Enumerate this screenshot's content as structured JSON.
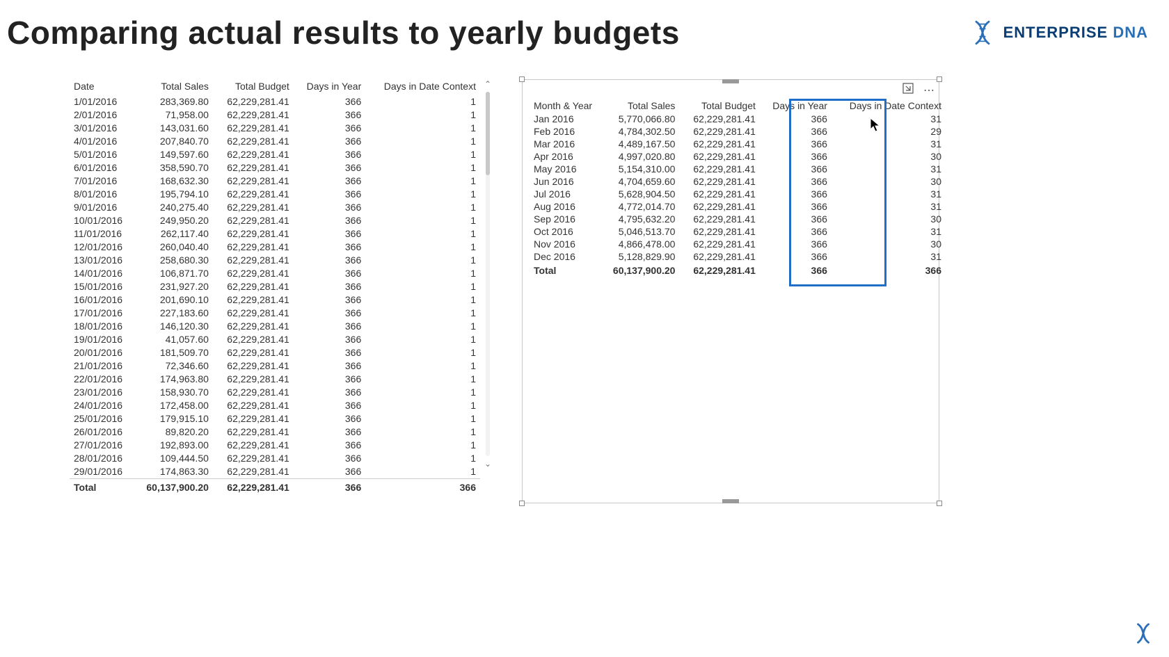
{
  "page_title": "Comparing actual results to yearly budgets",
  "brand": {
    "name1": "ENTERPRISE ",
    "name2": "DNA"
  },
  "left": {
    "headers": [
      "Date",
      "Total Sales",
      "Total Budget",
      "Days in Year",
      "Days in Date Context"
    ],
    "rows": [
      [
        "1/01/2016",
        "283,369.80",
        "62,229,281.41",
        "366",
        "1"
      ],
      [
        "2/01/2016",
        "71,958.00",
        "62,229,281.41",
        "366",
        "1"
      ],
      [
        "3/01/2016",
        "143,031.60",
        "62,229,281.41",
        "366",
        "1"
      ],
      [
        "4/01/2016",
        "207,840.70",
        "62,229,281.41",
        "366",
        "1"
      ],
      [
        "5/01/2016",
        "149,597.60",
        "62,229,281.41",
        "366",
        "1"
      ],
      [
        "6/01/2016",
        "358,590.70",
        "62,229,281.41",
        "366",
        "1"
      ],
      [
        "7/01/2016",
        "168,632.30",
        "62,229,281.41",
        "366",
        "1"
      ],
      [
        "8/01/2016",
        "195,794.10",
        "62,229,281.41",
        "366",
        "1"
      ],
      [
        "9/01/2016",
        "240,275.40",
        "62,229,281.41",
        "366",
        "1"
      ],
      [
        "10/01/2016",
        "249,950.20",
        "62,229,281.41",
        "366",
        "1"
      ],
      [
        "11/01/2016",
        "262,117.40",
        "62,229,281.41",
        "366",
        "1"
      ],
      [
        "12/01/2016",
        "260,040.40",
        "62,229,281.41",
        "366",
        "1"
      ],
      [
        "13/01/2016",
        "258,680.30",
        "62,229,281.41",
        "366",
        "1"
      ],
      [
        "14/01/2016",
        "106,871.70",
        "62,229,281.41",
        "366",
        "1"
      ],
      [
        "15/01/2016",
        "231,927.20",
        "62,229,281.41",
        "366",
        "1"
      ],
      [
        "16/01/2016",
        "201,690.10",
        "62,229,281.41",
        "366",
        "1"
      ],
      [
        "17/01/2016",
        "227,183.60",
        "62,229,281.41",
        "366",
        "1"
      ],
      [
        "18/01/2016",
        "146,120.30",
        "62,229,281.41",
        "366",
        "1"
      ],
      [
        "19/01/2016",
        "41,057.60",
        "62,229,281.41",
        "366",
        "1"
      ],
      [
        "20/01/2016",
        "181,509.70",
        "62,229,281.41",
        "366",
        "1"
      ],
      [
        "21/01/2016",
        "72,346.60",
        "62,229,281.41",
        "366",
        "1"
      ],
      [
        "22/01/2016",
        "174,963.80",
        "62,229,281.41",
        "366",
        "1"
      ],
      [
        "23/01/2016",
        "158,930.70",
        "62,229,281.41",
        "366",
        "1"
      ],
      [
        "24/01/2016",
        "172,458.00",
        "62,229,281.41",
        "366",
        "1"
      ],
      [
        "25/01/2016",
        "179,915.10",
        "62,229,281.41",
        "366",
        "1"
      ],
      [
        "26/01/2016",
        "89,820.20",
        "62,229,281.41",
        "366",
        "1"
      ],
      [
        "27/01/2016",
        "192,893.00",
        "62,229,281.41",
        "366",
        "1"
      ],
      [
        "28/01/2016",
        "109,444.50",
        "62,229,281.41",
        "366",
        "1"
      ],
      [
        "29/01/2016",
        "174,863.30",
        "62,229,281.41",
        "366",
        "1"
      ]
    ],
    "total": [
      "Total",
      "60,137,900.20",
      "62,229,281.41",
      "366",
      "366"
    ]
  },
  "right": {
    "headers": [
      "Month & Year",
      "Total Sales",
      "Total Budget",
      "Days in Year",
      "Days in Date Context"
    ],
    "rows": [
      [
        "Jan 2016",
        "5,770,066.80",
        "62,229,281.41",
        "366",
        "31"
      ],
      [
        "Feb 2016",
        "4,784,302.50",
        "62,229,281.41",
        "366",
        "29"
      ],
      [
        "Mar 2016",
        "4,489,167.50",
        "62,229,281.41",
        "366",
        "31"
      ],
      [
        "Apr 2016",
        "4,997,020.80",
        "62,229,281.41",
        "366",
        "30"
      ],
      [
        "May 2016",
        "5,154,310.00",
        "62,229,281.41",
        "366",
        "31"
      ],
      [
        "Jun 2016",
        "4,704,659.60",
        "62,229,281.41",
        "366",
        "30"
      ],
      [
        "Jul 2016",
        "5,628,904.50",
        "62,229,281.41",
        "366",
        "31"
      ],
      [
        "Aug 2016",
        "4,772,014.70",
        "62,229,281.41",
        "366",
        "31"
      ],
      [
        "Sep 2016",
        "4,795,632.20",
        "62,229,281.41",
        "366",
        "30"
      ],
      [
        "Oct 2016",
        "5,046,513.70",
        "62,229,281.41",
        "366",
        "31"
      ],
      [
        "Nov 2016",
        "4,866,478.00",
        "62,229,281.41",
        "366",
        "30"
      ],
      [
        "Dec 2016",
        "5,128,829.90",
        "62,229,281.41",
        "366",
        "31"
      ]
    ],
    "total": [
      "Total",
      "60,137,900.20",
      "62,229,281.41",
      "366",
      "366"
    ]
  }
}
